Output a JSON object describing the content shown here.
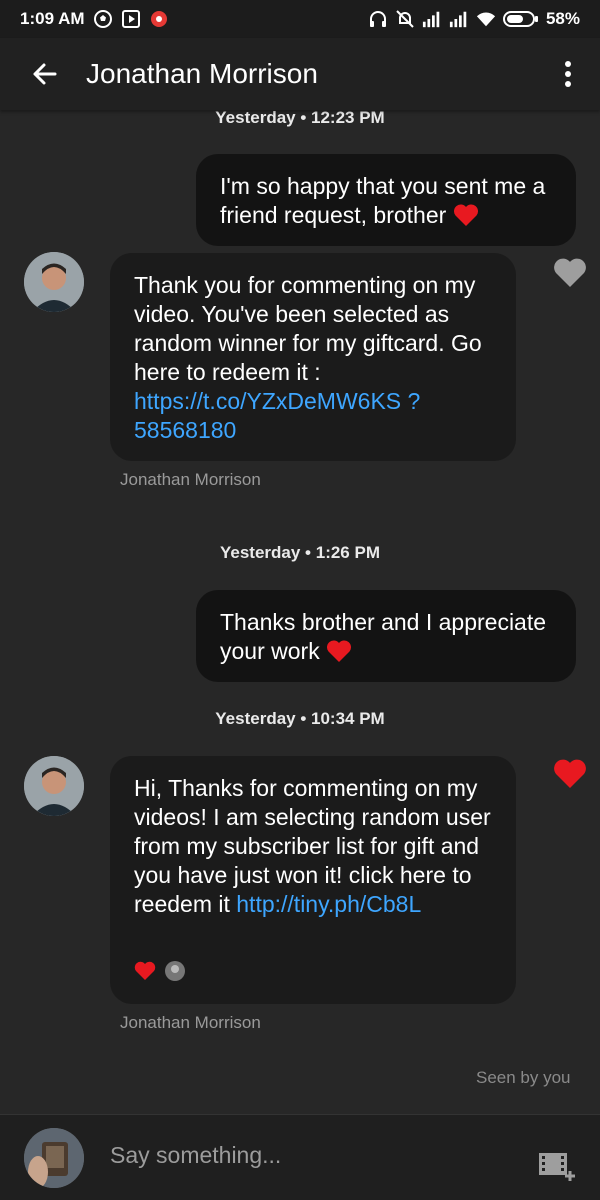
{
  "status": {
    "time": "1:09 AM",
    "battery": "58%",
    "icons": [
      "soccer-ball-icon",
      "play-store-icon",
      "record-icon",
      "headphones-icon",
      "muted-bell-icon",
      "signal-icon",
      "signal-icon",
      "wifi-icon",
      "battery-icon"
    ]
  },
  "header": {
    "title": "Jonathan Morrison",
    "back_icon": "back-arrow-icon",
    "menu_icon": "more-vert-icon"
  },
  "messages": [
    {
      "timestamp": "Yesterday • 12:23 PM"
    },
    {
      "from": "me",
      "text": "I'm so happy that you sent me a friend request, brother",
      "emoji": "❤️"
    },
    {
      "from": "Jonathan Morrison",
      "text": "Thank you for commenting on my video. You've been selected as random winner for my giftcard. Go here to redeem it :",
      "link": "https://t.co/YZxDeMW6KS ?58568180",
      "liked": false
    },
    {
      "timestamp": "Yesterday • 1:26 PM"
    },
    {
      "from": "me",
      "text": "Thanks brother and I appreciate your work",
      "emoji": "❤️"
    },
    {
      "timestamp": "Yesterday • 10:34 PM"
    },
    {
      "from": "Jonathan Morrison",
      "text": "Hi, Thanks for commenting on my videos! I am selecting random user from my subscriber list for gift and you have just won it! click here to reedem it",
      "link": "http://tiny.ph/Cb8L",
      "liked": true
    }
  ],
  "sender_name": "Jonathan Morrison",
  "seen": "Seen by you",
  "composer": {
    "placeholder": "Say something..."
  },
  "colors": {
    "accent_link": "#3ea6ff",
    "heart": "#e81920"
  }
}
